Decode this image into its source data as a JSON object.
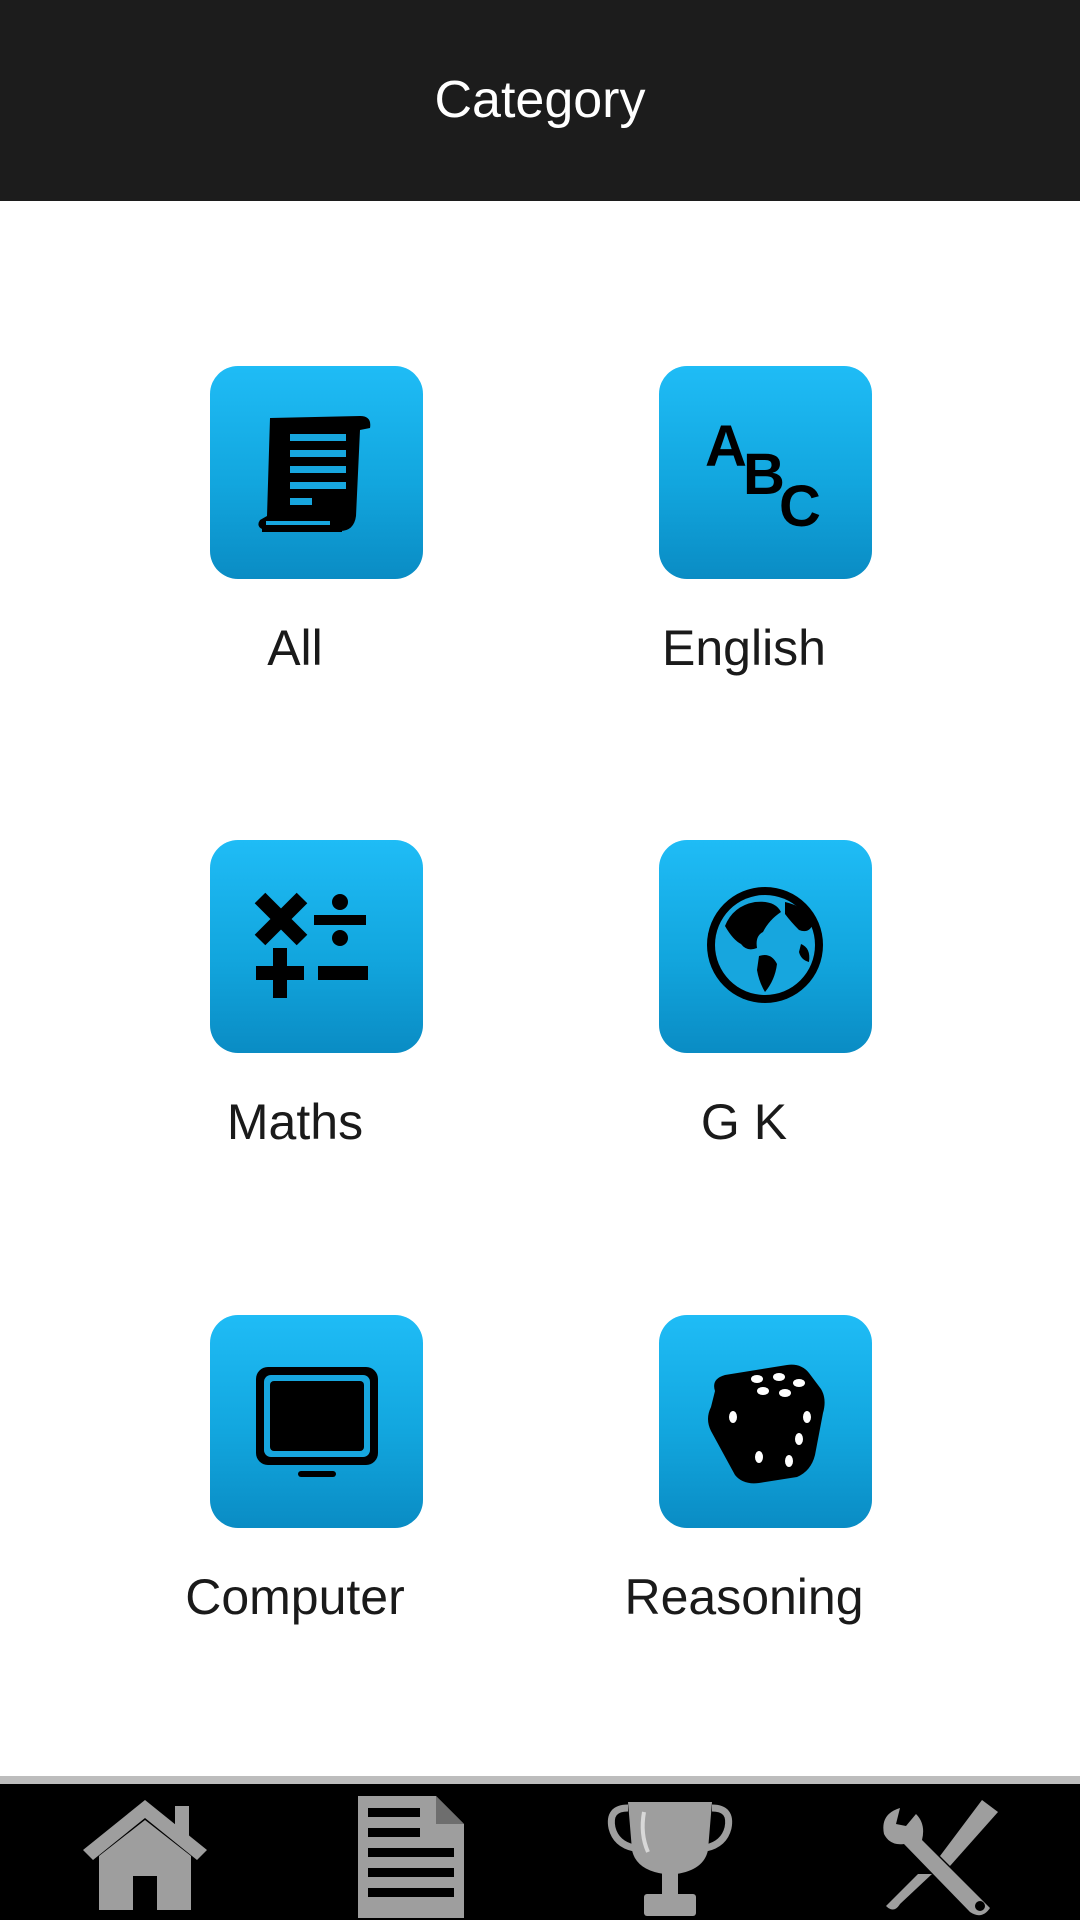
{
  "header": {
    "title": "Category"
  },
  "categories": [
    {
      "label": "All",
      "icon": "scroll-document-icon"
    },
    {
      "label": "English",
      "icon": "abc-letters-icon"
    },
    {
      "label": "Maths",
      "icon": "math-operators-icon"
    },
    {
      "label": "G K",
      "icon": "globe-icon"
    },
    {
      "label": "Computer",
      "icon": "monitor-icon"
    },
    {
      "label": "Reasoning",
      "icon": "dice-icon"
    }
  ],
  "bottom_nav": [
    {
      "icon": "home-icon"
    },
    {
      "icon": "document-icon"
    },
    {
      "icon": "trophy-icon"
    },
    {
      "icon": "tools-icon"
    }
  ],
  "colors": {
    "header_bg": "#1c1c1c",
    "tile_blue": "#12a6de",
    "nav_bg": "#000000",
    "nav_icon": "#9e9e9e"
  }
}
